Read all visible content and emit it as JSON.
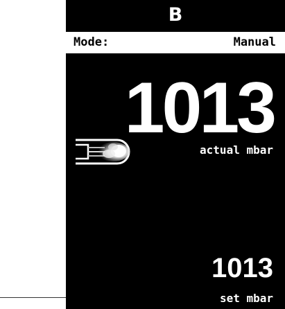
{
  "header": {
    "channel": "B"
  },
  "mode": {
    "label": "Mode:",
    "value": "Manual"
  },
  "actual": {
    "value": "1013",
    "unit": "actual mbar"
  },
  "setpoint": {
    "value": "1013",
    "unit": "set mbar"
  },
  "icons": {
    "flow": "vent-flow-icon"
  },
  "colors": {
    "screen_background": "#000000",
    "foreground": "#ffffff",
    "mode_bar_background": "#ffffff",
    "mode_bar_text": "#000000"
  }
}
